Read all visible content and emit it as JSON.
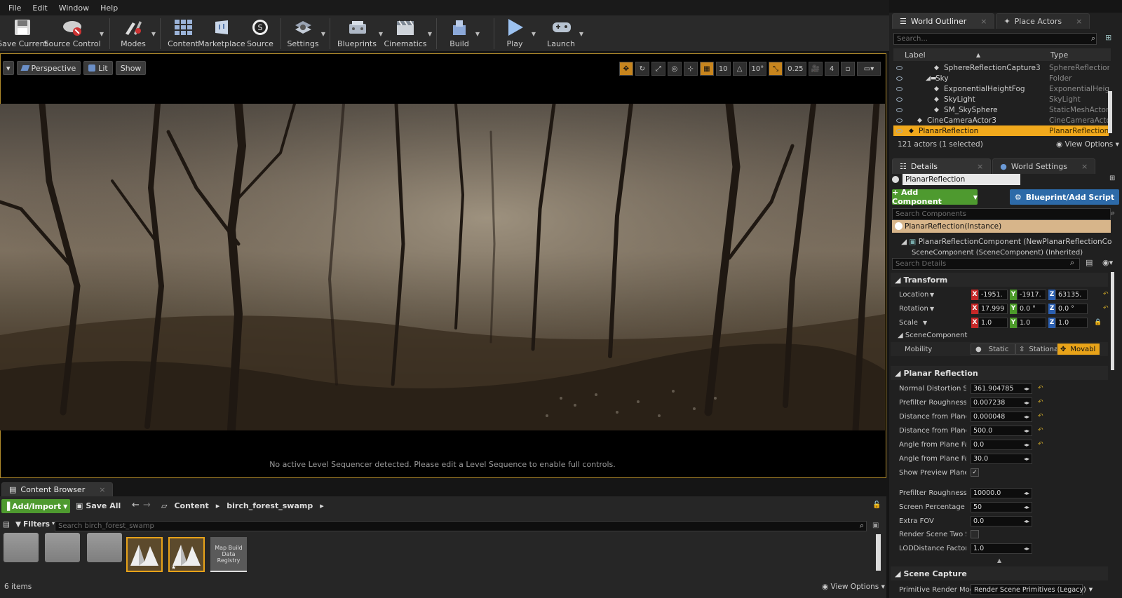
{
  "menu": [
    "File",
    "Edit",
    "Window",
    "Help"
  ],
  "toolbar": [
    {
      "label": "Save Current",
      "icon": "save-icon"
    },
    {
      "label": "Source Control",
      "icon": "source-control-icon"
    },
    {
      "label": "Modes",
      "icon": "modes-icon"
    },
    {
      "label": "Content",
      "icon": "content-icon"
    },
    {
      "label": "Marketplace",
      "icon": "marketplace-icon"
    },
    {
      "label": "Source",
      "icon": "source-icon"
    },
    {
      "label": "Settings",
      "icon": "settings-icon"
    },
    {
      "label": "Blueprints",
      "icon": "blueprints-icon"
    },
    {
      "label": "Cinematics",
      "icon": "cinematics-icon"
    },
    {
      "label": "Build",
      "icon": "build-icon"
    },
    {
      "label": "Play",
      "icon": "play-icon"
    },
    {
      "label": "Launch",
      "icon": "launch-icon"
    }
  ],
  "viewport": {
    "perspective": "Perspective",
    "lit": "Lit",
    "show": "Show",
    "grid_snap": "10",
    "rot_snap": "10°",
    "scale_snap": "0.25",
    "cam_speed": "4",
    "message": "No active Level Sequencer detected. Please edit a Level Sequence to enable full controls."
  },
  "outliner": {
    "tab1": "World Outliner",
    "tab2": "Place Actors",
    "search_placeholder": "Search...",
    "col_label": "Label",
    "col_type": "Type",
    "rows": [
      {
        "label": "SphereReflectionCapture3",
        "type": "SphereReflectionC",
        "indent": 3
      },
      {
        "label": "Sky",
        "type": "Folder",
        "indent": 2
      },
      {
        "label": "ExponentialHeightFog",
        "type": "ExponentialHeight",
        "indent": 3
      },
      {
        "label": "SkyLight",
        "type": "SkyLight",
        "indent": 3
      },
      {
        "label": "SM_SkySphere",
        "type": "StaticMeshActor",
        "indent": 3
      },
      {
        "label": "CineCameraActor3",
        "type": "CineCameraActor",
        "indent": 1
      },
      {
        "label": "PlanarReflection",
        "type": "PlanarReflection",
        "indent": 0,
        "selected": true
      }
    ],
    "count": "121 actors (1 selected)",
    "view_options": "View Options"
  },
  "details": {
    "tab1": "Details",
    "tab2": "World Settings",
    "name": "PlanarReflection",
    "add_component": "+ Add Component",
    "blueprint": "Blueprint/Add Script",
    "search_components": "Search Components",
    "instance": "PlanarReflection(Instance)",
    "component1": "PlanarReflectionComponent (NewPlanarReflectionComponent",
    "component2": "SceneComponent (SceneComponent) (Inherited)",
    "search_details": "Search Details",
    "transform": "Transform",
    "location": {
      "label": "Location",
      "x": "-1951.",
      "y": "-1917.",
      "z": "63135."
    },
    "rotation": {
      "label": "Rotation",
      "x": "17.999",
      "y": "0.0 °",
      "z": "0.0 °"
    },
    "scale": {
      "label": "Scale",
      "x": "1.0",
      "y": "1.0",
      "z": "1.0"
    },
    "scene_component": "SceneComponent",
    "mobility": "Mobility",
    "mob_static": "Static",
    "mob_stationary": "Stationa",
    "mob_movable": "Movabl",
    "planar": "Planar Reflection",
    "props": [
      {
        "label": "Normal Distortion Strer",
        "value": "361.904785"
      },
      {
        "label": "Prefilter Roughness",
        "value": "0.007238"
      },
      {
        "label": "Distance from Plane Fa",
        "value": "0.000048"
      },
      {
        "label": "Distance from Plane Fa",
        "value": "500.0"
      },
      {
        "label": "Angle from Plane Fade",
        "value": "0.0"
      },
      {
        "label": "Angle from Plane Fade",
        "value": "30.0"
      }
    ],
    "show_preview": "Show Preview Plane",
    "props2": [
      {
        "label": "Prefilter Roughness Dis",
        "value": "10000.0"
      },
      {
        "label": "Screen Percentage",
        "value": "50"
      },
      {
        "label": "Extra FOV",
        "value": "0.0"
      }
    ],
    "render_two": "Render Scene Two Side",
    "lod": {
      "label": "LODDistance Factor",
      "value": "1.0"
    },
    "scene_capture": "Scene Capture",
    "prim_label": "Primitive Render Mode",
    "prim_value": "Render Scene Primitives (Legacy)"
  },
  "content_browser": {
    "tab": "Content Browser",
    "add": "Add/Import",
    "save_all": "Save All",
    "path1": "Content",
    "path2": "birch_forest_swamp",
    "filters": "Filters",
    "search_placeholder": "Search birch_forest_swamp",
    "map_build": "Map Build Data Registry",
    "count": "6 items",
    "view_options": "View Options"
  }
}
